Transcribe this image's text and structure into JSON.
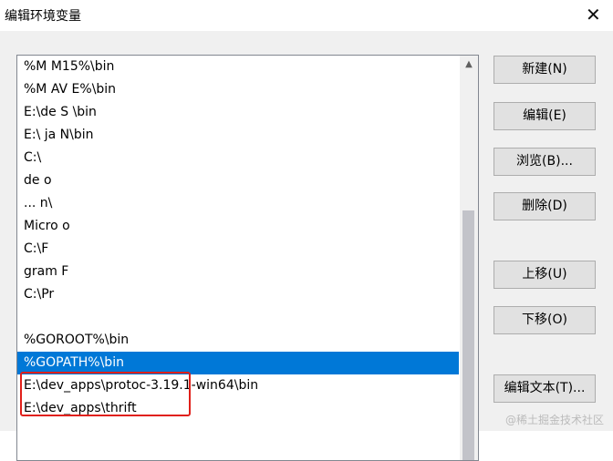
{
  "window": {
    "title": "编辑环境变量",
    "close_glyph": "✕"
  },
  "env_list": {
    "rows": [
      {
        "text": "%M       M15%\\bin",
        "selected": false
      },
      {
        "text": "%M  AV  E%\\bin",
        "selected": false
      },
      {
        "text": "E:\\de          S        \\bin",
        "selected": false
      },
      {
        "text": "E:\\      ja           N\\bin",
        "selected": false
      },
      {
        "text": "C:\\",
        "selected": false
      },
      {
        "text": "  de       o",
        "selected": false
      },
      {
        "text": "  ...                        n\\",
        "selected": false
      },
      {
        "text": "           Micro         o",
        "selected": false
      },
      {
        "text": "C:\\F",
        "selected": false
      },
      {
        "text": "  gram F",
        "selected": false
      },
      {
        "text": "C:\\Pr",
        "selected": false
      },
      {
        "text": "",
        "selected": false
      },
      {
        "text": "%GOROOT%\\bin",
        "selected": false
      },
      {
        "text": "%GOPATH%\\bin",
        "selected": true
      },
      {
        "text": "E:\\dev_apps\\protoc-3.19.1-win64\\bin",
        "selected": false
      },
      {
        "text": "E:\\dev_apps\\thrift",
        "selected": false
      }
    ],
    "scroll_up_glyph": "▲"
  },
  "buttons": {
    "new": "新建(N)",
    "edit": "编辑(E)",
    "browse": "浏览(B)...",
    "delete": "删除(D)",
    "move_up": "上移(U)",
    "move_down": "下移(O)",
    "edit_text": "编辑文本(T)..."
  },
  "watermark": "@稀土掘金技术社区",
  "colors": {
    "selection": "#0078d7",
    "highlight_box": "#e0201a"
  }
}
